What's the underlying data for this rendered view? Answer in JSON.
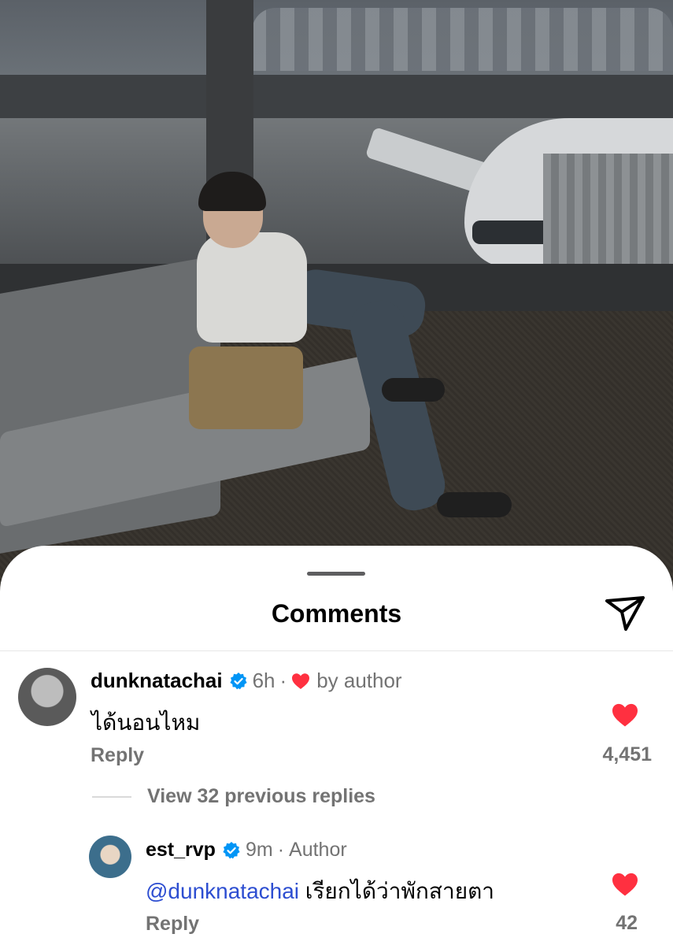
{
  "sheet": {
    "title": "Comments",
    "share_icon": "paper-plane-icon"
  },
  "comments": [
    {
      "username": "dunknatachai",
      "verified": true,
      "time": "6h",
      "badge": "by author",
      "text": "ได้นอนไหม",
      "reply_label": "Reply",
      "likes": "4,451",
      "liked": true,
      "view_replies": "View 32 previous replies"
    }
  ],
  "reply": {
    "username": "est_rvp",
    "verified": true,
    "time": "9m",
    "badge": "Author",
    "mention": "@dunknatachai",
    "text": " เรียกได้ว่าพักสายตา",
    "reply_label": "Reply",
    "likes": "42",
    "liked": true
  },
  "colors": {
    "like_red": "#ff3040",
    "verified_blue": "#0095f6",
    "mention_blue": "#2d4ed1",
    "secondary_text": "#737373"
  }
}
